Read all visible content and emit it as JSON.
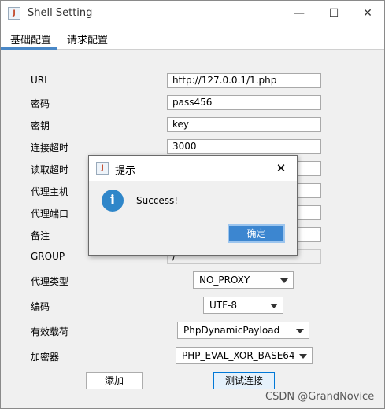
{
  "window": {
    "title": "Shell Setting",
    "min": "—",
    "max": "☐",
    "close": "✕"
  },
  "tabs": [
    {
      "label": "基础配置"
    },
    {
      "label": "请求配置"
    }
  ],
  "form": {
    "url_label": "URL",
    "url_value": "http://127.0.0.1/1.php",
    "password_label": "密码",
    "password_value": "pass456",
    "key_label": "密钥",
    "key_value": "key",
    "conn_timeout_label": "连接超时",
    "conn_timeout_value": "3000",
    "read_timeout_label": "读取超时",
    "read_timeout_value": "",
    "proxy_host_label": "代理主机",
    "proxy_host_value": "",
    "proxy_port_label": "代理端口",
    "proxy_port_value": "",
    "remark_label": "备注",
    "remark_value": "",
    "group_label": "GROUP",
    "group_value": "/",
    "proxy_type_label": "代理类型",
    "proxy_type_value": "NO_PROXY",
    "encoding_label": "编码",
    "encoding_value": "UTF-8",
    "payload_label": "有效载荷",
    "payload_value": "PhpDynamicPayload",
    "encryptor_label": "加密器",
    "encryptor_value": "PHP_EVAL_XOR_BASE64"
  },
  "buttons": {
    "add": "添加",
    "test": "测试连接"
  },
  "dialog": {
    "title": "提示",
    "message": "Success!",
    "ok": "确定",
    "info_glyph": "i",
    "close": "✕"
  },
  "watermark": "CSDN @GrandNovice",
  "colors": {
    "accent": "#3c86d0",
    "tab_indicator": "#4a88c7"
  },
  "icons": {
    "app": "java-icon",
    "dialog_info": "info-icon"
  }
}
